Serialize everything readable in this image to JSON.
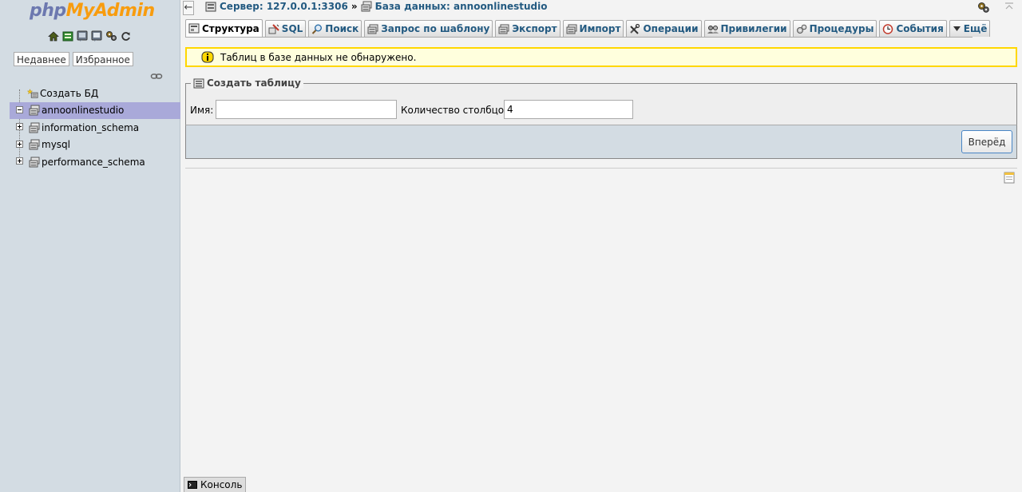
{
  "sidebar": {
    "logo": {
      "part1": "php",
      "part2": "MyAdmin"
    },
    "nav_icons": [
      "home-icon",
      "exit-icon",
      "docs-icon",
      "sql-docs-icon",
      "settings-icon",
      "reload-icon"
    ],
    "tabs": {
      "recent": "Недавнее",
      "favorites": "Избранное"
    },
    "tree": {
      "create_db": "Создать БД",
      "databases": [
        {
          "name": "annoonlinestudio",
          "selected": true
        },
        {
          "name": "information_schema",
          "selected": false
        },
        {
          "name": "mysql",
          "selected": false
        },
        {
          "name": "performance_schema",
          "selected": false
        }
      ]
    }
  },
  "header": {
    "server": "Сервер: 127.0.0.1:3306",
    "separator": "»",
    "database": "База данных: annoonlinestudio"
  },
  "tabs": [
    {
      "label": "Структура",
      "icon": "structure-icon",
      "active": true
    },
    {
      "label": "SQL",
      "icon": "sql-icon",
      "active": false
    },
    {
      "label": "Поиск",
      "icon": "search-icon",
      "active": false
    },
    {
      "label": "Запрос по шаблону",
      "icon": "query-icon",
      "active": false
    },
    {
      "label": "Экспорт",
      "icon": "export-icon",
      "active": false
    },
    {
      "label": "Импорт",
      "icon": "import-icon",
      "active": false
    },
    {
      "label": "Операции",
      "icon": "operations-icon",
      "active": false
    },
    {
      "label": "Привилегии",
      "icon": "privileges-icon",
      "active": false
    },
    {
      "label": "Процедуры",
      "icon": "routines-icon",
      "active": false
    },
    {
      "label": "События",
      "icon": "events-icon",
      "active": false
    },
    {
      "label": "Ещё",
      "icon": "chevron-down-icon",
      "active": false
    }
  ],
  "notice": {
    "text": "Таблиц в базе данных не обнаружено."
  },
  "create_table": {
    "legend": "Создать таблицу",
    "name_label": "Имя:",
    "name_value": "",
    "columns_label": "Количество столбцов:",
    "columns_value": "4",
    "go_label": "Вперёд"
  },
  "console": {
    "label": "Консоль"
  },
  "colors": {
    "link": "#235a81",
    "sidebar_bg": "#d3dce3",
    "selected_row": "#a9a9d9",
    "notice_border": "#ffd700"
  }
}
